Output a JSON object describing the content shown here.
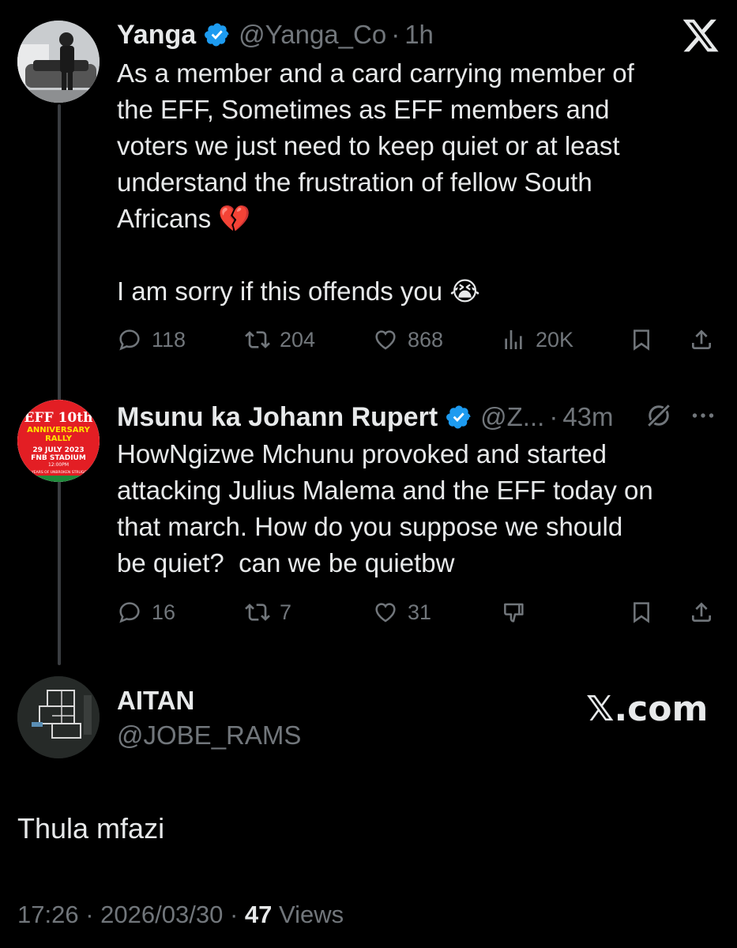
{
  "tweet1": {
    "name": "Yanga",
    "handle": "@Yanga_Co",
    "sep": "·",
    "time": "1h",
    "body": "As a member and a card carrying member of\nthe EFF, Sometimes as EFF members and\nvoters we just need to keep quiet or at least\nunderstand the frustration of fellow South\nAfricans 💔\n\nI am sorry if this offends you 😭",
    "replies": "118",
    "reposts": "204",
    "likes": "868",
    "views": "20K"
  },
  "tweet2": {
    "name": "Msunu ka Johann Rupert",
    "handle": "@Z...",
    "sep": "·",
    "time": "43m",
    "body": "HowNgizwe Mchunu provoked and started\nattacking Julius Malema and the EFF today on\nthat march. How do you suppose we should\nbe quiet?  can we be quietbw",
    "replies": "16",
    "reposts": "7",
    "likes": "31",
    "avatar_text": {
      "line1": "EFF 10th",
      "line2": "ANNIVERSARY",
      "line3": "RALLY",
      "line4": "29 JULY 2023",
      "line5": "FNB STADIUM",
      "line6": "12:00PM",
      "line7": "10 YEARS OF UNBROKEN STRUGGLE"
    }
  },
  "reply": {
    "name": "AITAN",
    "handle": "@JOBE_RAMS",
    "body": "Thula mfazi",
    "time": "17:26",
    "sep": "·",
    "date": "2026/03/30",
    "views_count": "47",
    "views_label": "Views"
  },
  "brand": {
    "logo": "𝕏",
    "watermark": "𝕏.com"
  },
  "colors": {
    "background": "#000000",
    "text": "#e7e9ea",
    "muted": "#71767b",
    "verified": "#1d9bf0",
    "thread_line": "#3a3d41"
  }
}
